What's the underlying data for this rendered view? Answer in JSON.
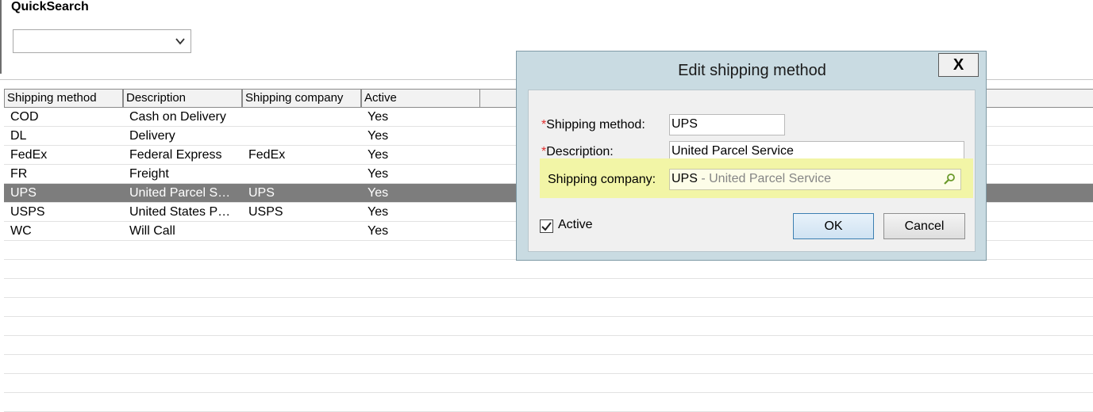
{
  "quicksearch": {
    "title": "QuickSearch",
    "selected_value": ""
  },
  "grid": {
    "columns": [
      "Shipping method",
      "Description",
      "Shipping company",
      "Active"
    ],
    "rows": [
      {
        "method": "COD",
        "description": "Cash on Delivery",
        "company": "",
        "active": "Yes",
        "selected": false
      },
      {
        "method": "DL",
        "description": "Delivery",
        "company": "",
        "active": "Yes",
        "selected": false
      },
      {
        "method": "FedEx",
        "description": "Federal Express",
        "company": "FedEx",
        "active": "Yes",
        "selected": false
      },
      {
        "method": "FR",
        "description": "Freight",
        "company": "",
        "active": "Yes",
        "selected": false
      },
      {
        "method": "UPS",
        "description": "United Parcel S…",
        "company": "UPS",
        "active": "Yes",
        "selected": true
      },
      {
        "method": "USPS",
        "description": "United States P…",
        "company": "USPS",
        "active": "Yes",
        "selected": false
      },
      {
        "method": "WC",
        "description": "Will Call",
        "company": "",
        "active": "Yes",
        "selected": false
      }
    ]
  },
  "dialog": {
    "title": "Edit shipping method",
    "close_label": "X",
    "required_marker": "*",
    "method_label": "Shipping method:",
    "method_value": "UPS",
    "description_label": "Description:",
    "description_value": "United Parcel Service",
    "company_label": "Shipping company:",
    "company_code": "UPS",
    "company_name": " - United Parcel Service",
    "active_label": "Active",
    "active_checked": true,
    "ok_label": "OK",
    "cancel_label": "Cancel"
  },
  "colors": {
    "selected_row": "#7d7d7d",
    "dialog_frame": "#c9dbe2",
    "highlight": "#f2f5a6",
    "required": "#e03030"
  },
  "icons": [
    "chevron-down-icon",
    "close-icon",
    "magnifier-icon",
    "checkmark-icon"
  ]
}
